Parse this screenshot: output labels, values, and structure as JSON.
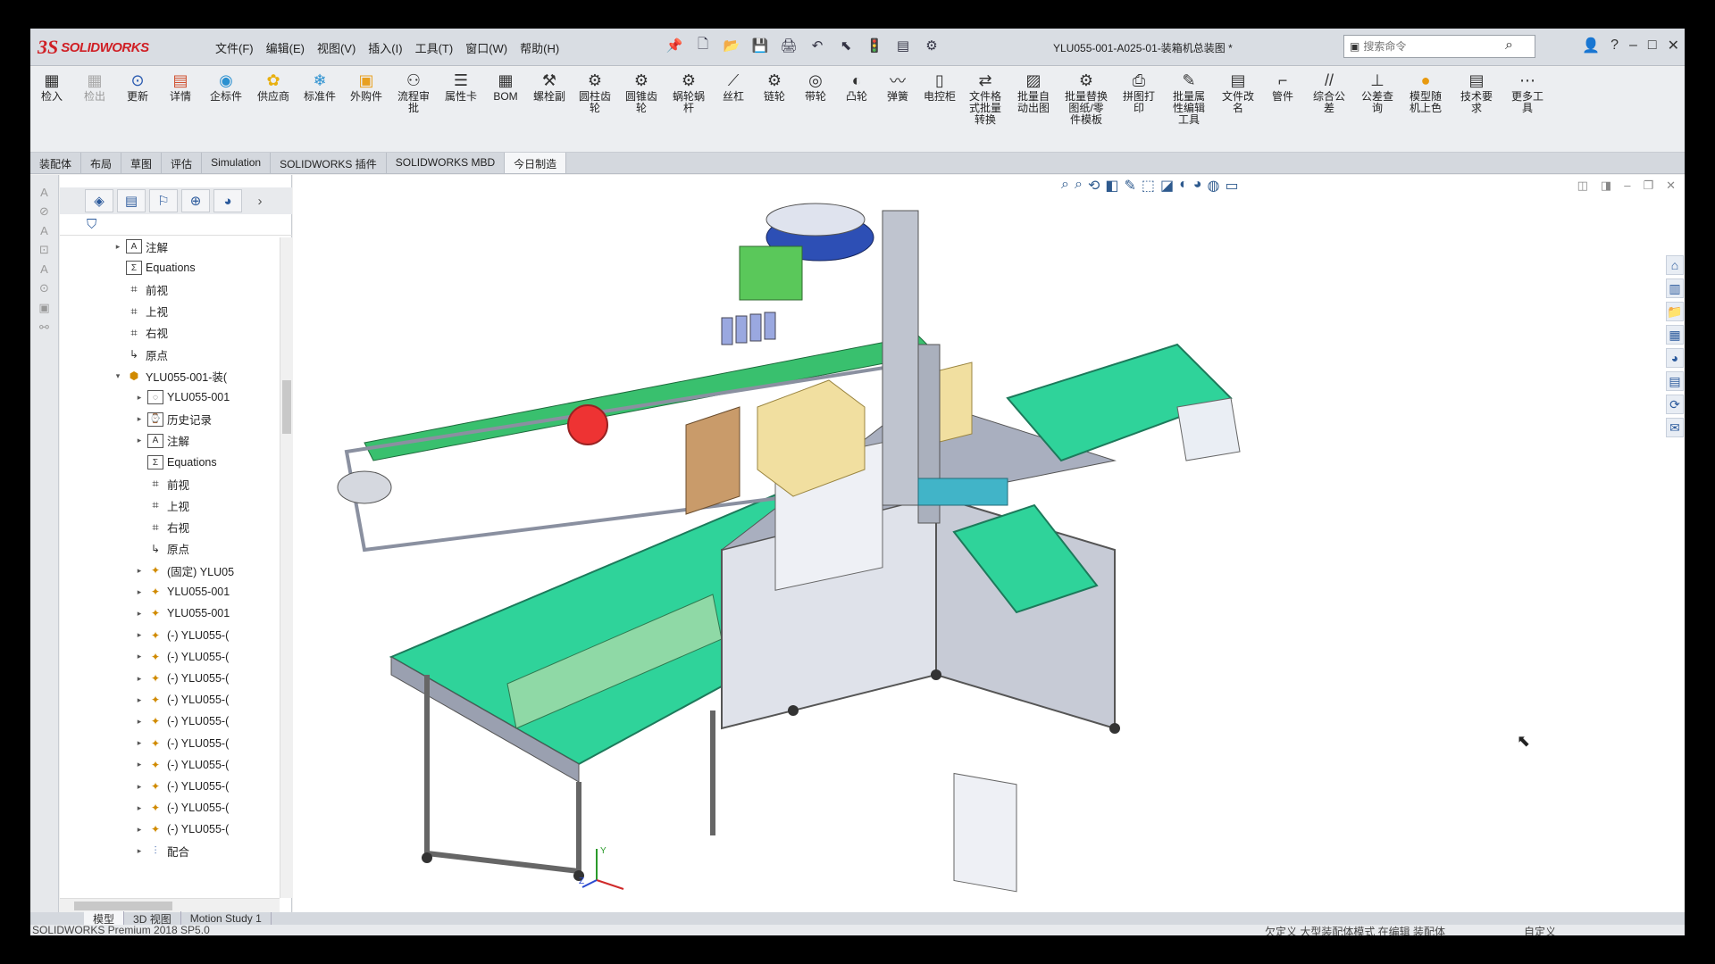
{
  "app": {
    "brand_ds": "3S",
    "brand_name": "SOLIDWORKS"
  },
  "menu": [
    "文件(F)",
    "编辑(E)",
    "视图(V)",
    "插入(I)",
    "工具(T)",
    "窗口(W)",
    "帮助(H)"
  ],
  "document_title": "YLU055-001-A025-01-装箱机总装图 *",
  "search": {
    "placeholder": "搜索命令"
  },
  "ribbon": [
    {
      "label": "检入",
      "icon": "pdm-icon",
      "dim": false
    },
    {
      "label": "检出",
      "icon": "pdm-icon",
      "dim": true
    },
    {
      "label": "更新",
      "icon": "update-icon",
      "dim": false
    },
    {
      "label": "详情",
      "icon": "details-icon",
      "dim": false
    },
    {
      "label": "企标件",
      "icon": "standard-icon",
      "dim": false
    },
    {
      "label": "供应商",
      "icon": "supplier-icon",
      "dim": false
    },
    {
      "label": "标准件",
      "icon": "snowflake-icon",
      "dim": false
    },
    {
      "label": "外购件",
      "icon": "purchase-icon",
      "dim": false
    },
    {
      "label": "流程审\n批",
      "icon": "workflow-icon",
      "dim": false
    },
    {
      "label": "属性卡",
      "icon": "property-card-icon",
      "dim": false
    },
    {
      "label": "BOM",
      "icon": "bom-icon",
      "dim": false
    },
    {
      "label": "螺栓副",
      "icon": "bolt-icon",
      "dim": false
    },
    {
      "label": "圆柱齿\n轮",
      "icon": "spur-gear-icon",
      "dim": false
    },
    {
      "label": "圆锥齿\n轮",
      "icon": "bevel-gear-icon",
      "dim": false
    },
    {
      "label": "蜗轮蜗\n杆",
      "icon": "worm-gear-icon",
      "dim": false
    },
    {
      "label": "丝杠",
      "icon": "lead-screw-icon",
      "dim": false
    },
    {
      "label": "链轮",
      "icon": "sprocket-icon",
      "dim": false
    },
    {
      "label": "带轮",
      "icon": "pulley-icon",
      "dim": false
    },
    {
      "label": "凸轮",
      "icon": "cam-icon",
      "dim": false
    },
    {
      "label": "弹簧",
      "icon": "spring-icon",
      "dim": false
    },
    {
      "label": "电控柜",
      "icon": "cabinet-icon",
      "dim": false
    },
    {
      "label": "文件格\n式批量\n转换",
      "icon": "convert-icon",
      "dim": false
    },
    {
      "label": "批量自\n动出图",
      "icon": "drawing-icon",
      "dim": false
    },
    {
      "label": "批量替换\n图纸/零\n件模板",
      "icon": "template-icon",
      "dim": false
    },
    {
      "label": "拼图打\n印",
      "icon": "print-icon",
      "dim": false
    },
    {
      "label": "批量属\n性编辑\n工具",
      "icon": "edit-icon",
      "dim": false
    },
    {
      "label": "文件改\n名",
      "icon": "rename-icon",
      "dim": false
    },
    {
      "label": "管件",
      "icon": "pipe-icon",
      "dim": false
    },
    {
      "label": "综合公\n差",
      "icon": "tolerance-icon",
      "dim": false
    },
    {
      "label": "公差查\n询",
      "icon": "query-icon",
      "dim": false
    },
    {
      "label": "模型随\n机上色",
      "icon": "color-icon",
      "dim": false
    },
    {
      "label": "技术要\n求",
      "icon": "tech-icon",
      "dim": false
    },
    {
      "label": "更多工\n具",
      "icon": "more-icon",
      "dim": false
    }
  ],
  "tabs": [
    "装配体",
    "布局",
    "草图",
    "评估",
    "Simulation",
    "SOLIDWORKS 插件",
    "SOLIDWORKS MBD",
    "今日制造"
  ],
  "active_tab": "今日制造",
  "tree": [
    {
      "indent": 0,
      "expander": "▸",
      "icon": "annotation",
      "label": "注解"
    },
    {
      "indent": 0,
      "expander": "",
      "icon": "equation",
      "label": "Equations"
    },
    {
      "indent": 0,
      "expander": "",
      "icon": "plane",
      "label": "前视"
    },
    {
      "indent": 0,
      "expander": "",
      "icon": "plane",
      "label": "上视"
    },
    {
      "indent": 0,
      "expander": "",
      "icon": "plane",
      "label": "右视"
    },
    {
      "indent": 0,
      "expander": "",
      "icon": "origin",
      "label": "原点"
    },
    {
      "indent": 0,
      "expander": "▾",
      "icon": "assembly",
      "label": "YLU055-001-装("
    },
    {
      "indent": 1,
      "expander": "▸",
      "icon": "sensor",
      "label": "YLU055-001"
    },
    {
      "indent": 1,
      "expander": "▸",
      "icon": "history",
      "label": "历史记录"
    },
    {
      "indent": 1,
      "expander": "▸",
      "icon": "annotation",
      "label": "注解"
    },
    {
      "indent": 1,
      "expander": "",
      "icon": "equation",
      "label": "Equations"
    },
    {
      "indent": 1,
      "expander": "",
      "icon": "plane",
      "label": "前视"
    },
    {
      "indent": 1,
      "expander": "",
      "icon": "plane",
      "label": "上视"
    },
    {
      "indent": 1,
      "expander": "",
      "icon": "plane",
      "label": "右视"
    },
    {
      "indent": 1,
      "expander": "",
      "icon": "origin",
      "label": "原点"
    },
    {
      "indent": 1,
      "expander": "▸",
      "icon": "part",
      "label": "(固定) YLU05"
    },
    {
      "indent": 1,
      "expander": "▸",
      "icon": "part",
      "label": "YLU055-001"
    },
    {
      "indent": 1,
      "expander": "▸",
      "icon": "part",
      "label": "YLU055-001"
    },
    {
      "indent": 1,
      "expander": "▸",
      "icon": "part",
      "label": "(-) YLU055-("
    },
    {
      "indent": 1,
      "expander": "▸",
      "icon": "part",
      "label": "(-) YLU055-("
    },
    {
      "indent": 1,
      "expander": "▸",
      "icon": "part",
      "label": "(-) YLU055-("
    },
    {
      "indent": 1,
      "expander": "▸",
      "icon": "part",
      "label": "(-) YLU055-("
    },
    {
      "indent": 1,
      "expander": "▸",
      "icon": "part",
      "label": "(-) YLU055-("
    },
    {
      "indent": 1,
      "expander": "▸",
      "icon": "part",
      "label": "(-) YLU055-("
    },
    {
      "indent": 1,
      "expander": "▸",
      "icon": "part",
      "label": "(-) YLU055-("
    },
    {
      "indent": 1,
      "expander": "▸",
      "icon": "part",
      "label": "(-) YLU055-("
    },
    {
      "indent": 1,
      "expander": "▸",
      "icon": "part",
      "label": "(-) YLU055-("
    },
    {
      "indent": 1,
      "expander": "▸",
      "icon": "part",
      "label": "(-) YLU055-("
    },
    {
      "indent": 1,
      "expander": "▸",
      "icon": "mate",
      "label": "配合"
    }
  ],
  "bottom_tabs": [
    "模型",
    "3D 视图",
    "Motion Study 1"
  ],
  "status": {
    "version": "SOLIDWORKS Premium 2018 SP5.0",
    "state": "欠定义   大型装配体模式   在编辑 装配体",
    "units": "自定义"
  },
  "colors": {
    "conveyor": "#2fd39a",
    "frame": "#9aa0b0",
    "accent_red": "#d01f25"
  }
}
